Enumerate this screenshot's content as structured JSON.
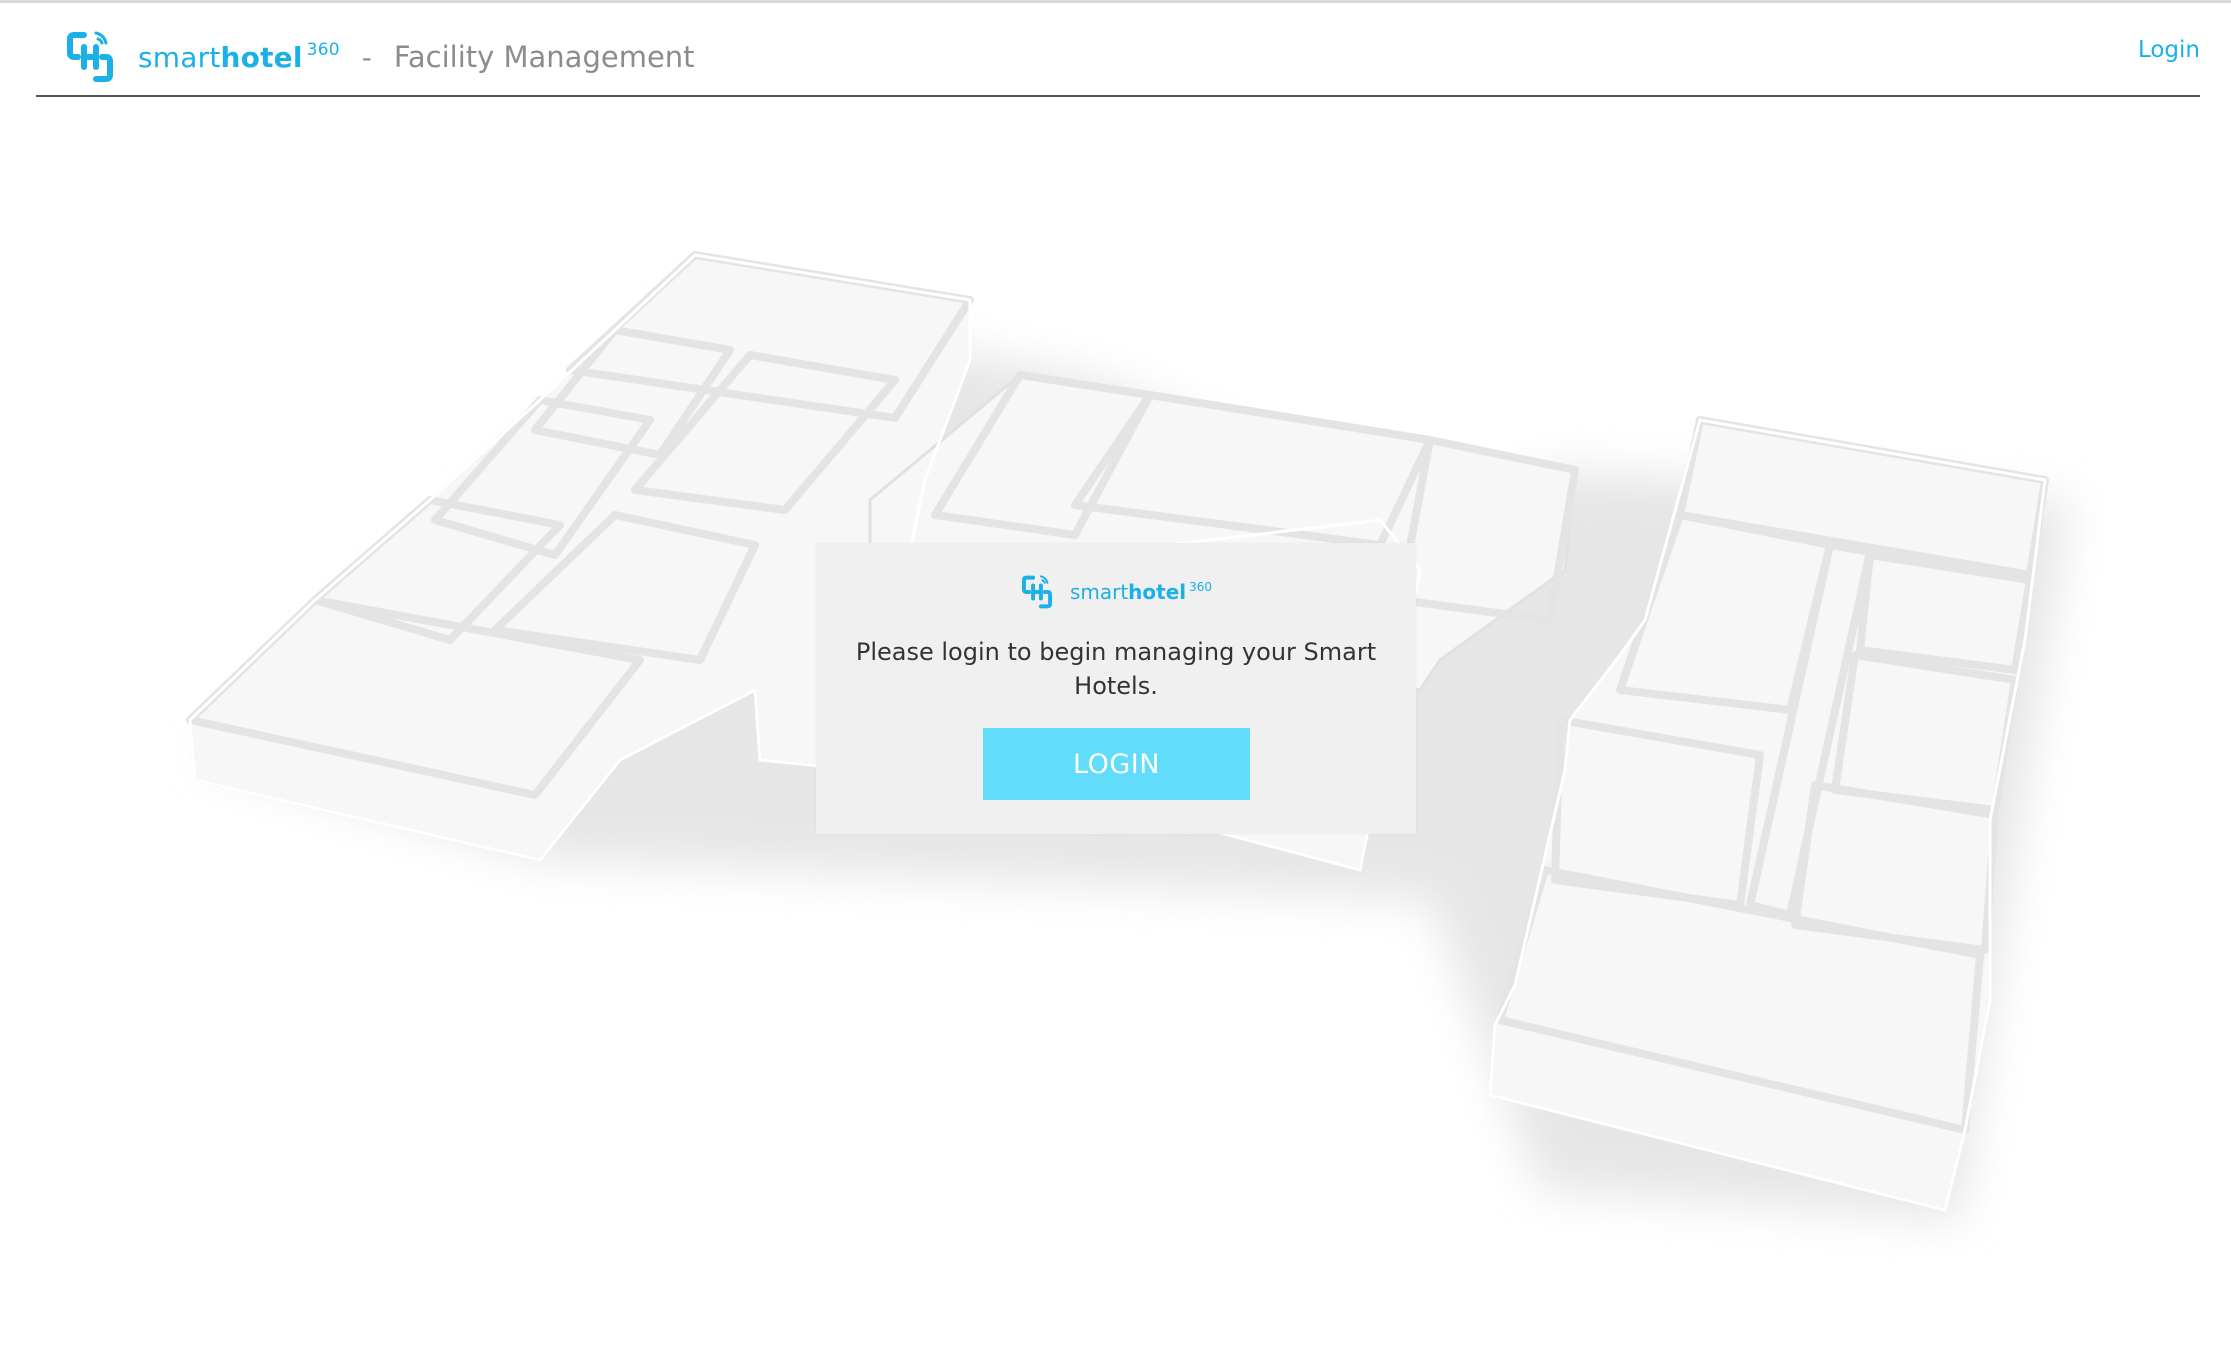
{
  "header": {
    "brand": {
      "name_light": "smart",
      "name_bold": "hotel",
      "superscript": "360"
    },
    "separator": "-",
    "subtitle": "Facility Management",
    "login_link": "Login"
  },
  "login_card": {
    "brand": {
      "name_light": "smart",
      "name_bold": "hotel",
      "superscript": "360"
    },
    "message": "Please login to begin managing your Smart Hotels.",
    "button": "LOGIN"
  },
  "colors": {
    "brand": "#1bb1e8",
    "button": "#62dcfb",
    "card_bg": "#f0f0f0",
    "muted_text": "#8c8c8c"
  },
  "icons": {
    "brand_logo": "smarthotel-logo-icon",
    "card_logo": "smarthotel-logo-icon"
  }
}
